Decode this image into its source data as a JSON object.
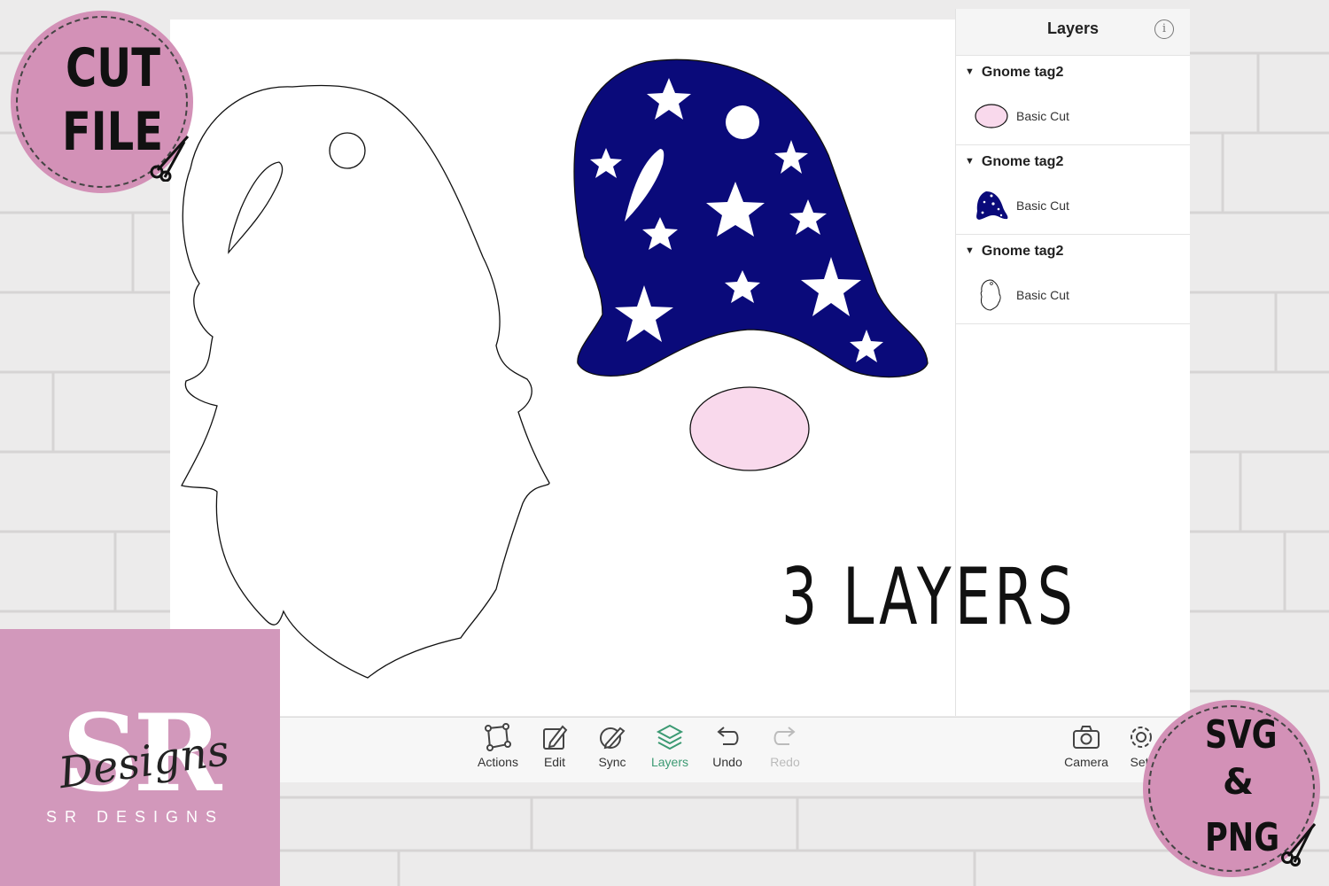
{
  "panel": {
    "title": "Layers",
    "info_icon": "info-icon",
    "groups": [
      {
        "name": "Gnome tag2",
        "item": "Basic Cut",
        "thumb": "pink-oval"
      },
      {
        "name": "Gnome tag2",
        "item": "Basic Cut",
        "thumb": "starry-hat"
      },
      {
        "name": "Gnome tag2",
        "item": "Basic Cut",
        "thumb": "gnome-outline"
      }
    ]
  },
  "toolbar": {
    "actions": "Actions",
    "edit": "Edit",
    "sync": "Sync",
    "layers": "Layers",
    "undo": "Undo",
    "redo": "Redo",
    "camera": "Camera",
    "settings": "Sett"
  },
  "overlay": {
    "cut_line1": "CUT",
    "cut_line2": "FILE",
    "caption": "3 LAYERS",
    "svg_line1": "SVG",
    "svg_line2": "&",
    "svg_line3": "PNG",
    "brand_monogram": "SR",
    "brand_script": "Designs",
    "brand_name": "SR DESIGNS"
  },
  "colors": {
    "hat": "#0a0a7a",
    "nose": "#f9d9ec",
    "badge": "#d391b7",
    "active_tab": "#3c9a73"
  }
}
